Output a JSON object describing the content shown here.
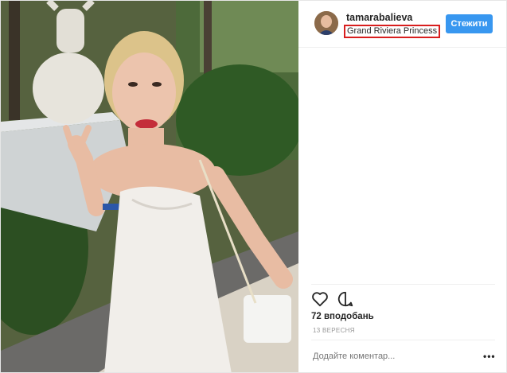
{
  "post": {
    "username": "tamarabalieva",
    "location": "Grand Riviera Princess",
    "follow_label": "Стежити",
    "likes": "72 вподобань",
    "date": "13 ВЕРЕСНЯ",
    "comment_placeholder": "Додайте коментар...",
    "more_label": "•••"
  },
  "icons": {
    "like": "heart-icon",
    "comment": "comment-icon",
    "more": "more-options-icon"
  },
  "colors": {
    "follow_button": "#3897f0",
    "location_highlight": "#d81e1e"
  }
}
